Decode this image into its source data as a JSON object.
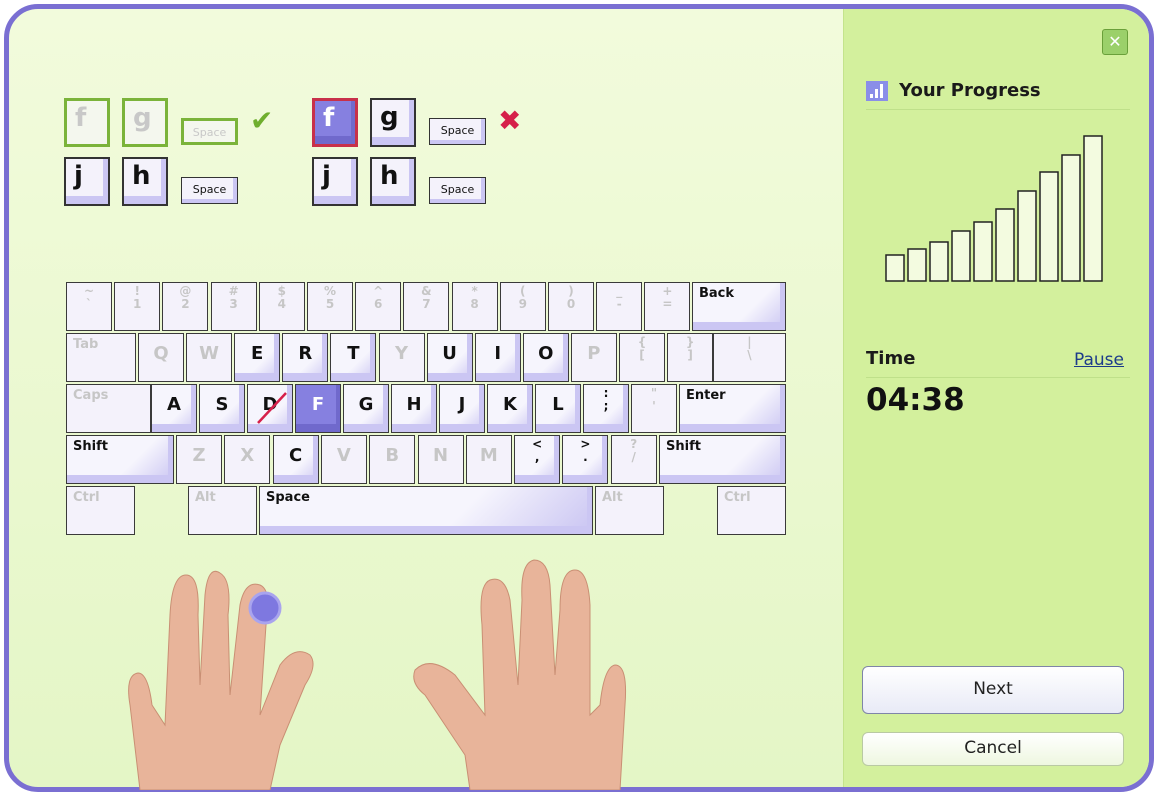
{
  "close_icon": "close-icon",
  "exercises": [
    {
      "status": "correct",
      "rows": [
        [
          "f",
          "g",
          "Space"
        ],
        [
          "j",
          "h",
          "Space"
        ]
      ]
    },
    {
      "status": "wrong",
      "rows": [
        [
          "f",
          "g",
          "Space"
        ],
        [
          "j",
          "h",
          "Space"
        ]
      ]
    }
  ],
  "keyboard": {
    "rows": [
      [
        [
          "~`",
          "inactive"
        ],
        [
          "!1",
          "inactive"
        ],
        [
          "@2",
          "inactive"
        ],
        [
          "#3",
          "inactive"
        ],
        [
          "$4",
          "inactive"
        ],
        [
          "%5",
          "inactive"
        ],
        [
          "^6",
          "inactive"
        ],
        [
          "&7",
          "inactive"
        ],
        [
          "*8",
          "inactive"
        ],
        [
          "(9",
          "inactive"
        ],
        [
          ")0",
          "inactive"
        ],
        [
          "_-",
          "inactive"
        ],
        [
          "+=",
          "inactive"
        ],
        [
          "Back",
          "mod"
        ]
      ],
      [
        [
          "Tab",
          "inactivemod"
        ],
        [
          "Q",
          "inactive"
        ],
        [
          "W",
          "inactive"
        ],
        [
          "E",
          "active"
        ],
        [
          "R",
          "active"
        ],
        [
          "T",
          "active"
        ],
        [
          "Y",
          "inactive"
        ],
        [
          "U",
          "active"
        ],
        [
          "I",
          "active"
        ],
        [
          "O",
          "active"
        ],
        [
          "P",
          "inactive"
        ],
        [
          "{[",
          "inactive"
        ],
        [
          "}]",
          "inactive"
        ],
        [
          "|\\",
          "inactive"
        ]
      ],
      [
        [
          "Caps",
          "inactivemod"
        ],
        [
          "A",
          "active"
        ],
        [
          "S",
          "active"
        ],
        [
          "D",
          "wrong"
        ],
        [
          "F",
          "pressed"
        ],
        [
          "G",
          "active"
        ],
        [
          "H",
          "active"
        ],
        [
          "J",
          "active"
        ],
        [
          "K",
          "active"
        ],
        [
          "L",
          "active"
        ],
        [
          ":;",
          "active"
        ],
        [
          "\"'",
          "inactive"
        ],
        [
          "Enter",
          "mod"
        ]
      ],
      [
        [
          "Shift",
          "mod"
        ],
        [
          "Z",
          "inactive"
        ],
        [
          "X",
          "inactive"
        ],
        [
          "C",
          "active"
        ],
        [
          "V",
          "inactive"
        ],
        [
          "B",
          "inactive"
        ],
        [
          "N",
          "inactive"
        ],
        [
          "M",
          "inactive"
        ],
        [
          "<,",
          "active"
        ],
        [
          ">.",
          "active"
        ],
        [
          "?/",
          "inactive"
        ],
        [
          "Shift",
          "mod"
        ]
      ],
      [
        [
          "Ctrl",
          "inactivemod"
        ],
        [
          "Alt",
          "inactivemod"
        ],
        [
          "Space",
          "mod"
        ],
        [
          "Alt",
          "inactivemod"
        ],
        [
          "Ctrl",
          "inactivemod"
        ]
      ]
    ]
  },
  "progress": {
    "title": "Your Progress",
    "icon": "bar-chart-icon"
  },
  "chart_data": {
    "type": "bar",
    "values": [
      26,
      32,
      39,
      50,
      59,
      72,
      90,
      109,
      126,
      145
    ],
    "ylim": [
      0,
      150
    ]
  },
  "time": {
    "label": "Time",
    "pause": "Pause",
    "value": "04:38"
  },
  "buttons": {
    "next": "Next",
    "cancel": "Cancel"
  },
  "colors": {
    "accent": "#7a6fd2",
    "panel": "#d3f09d",
    "pressed": "#8680e0",
    "error": "#d6204a",
    "ok": "#6fae2e"
  }
}
